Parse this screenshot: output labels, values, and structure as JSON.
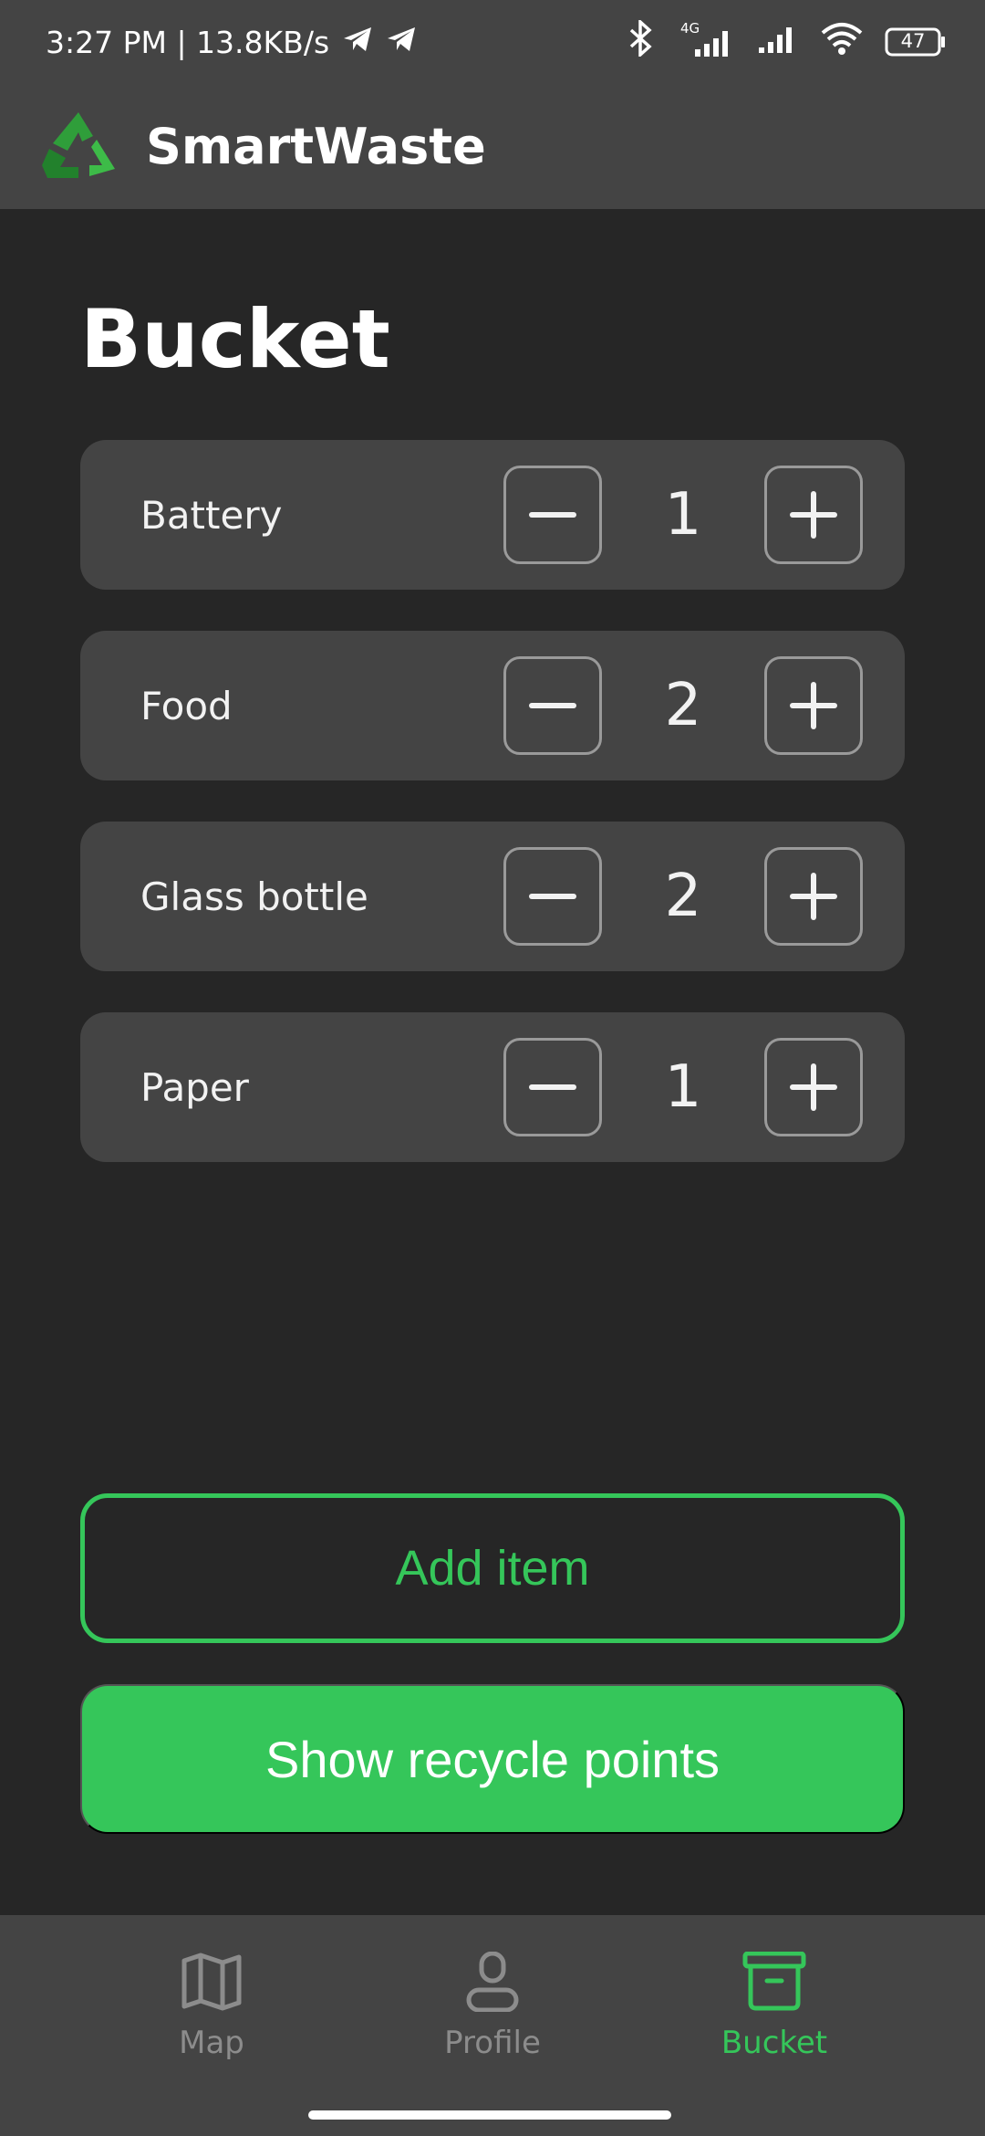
{
  "status_bar": {
    "time_speed": "3:27 PM | 13.8KB/s",
    "network_label": "4G",
    "battery": "47"
  },
  "app": {
    "title": "SmartWaste",
    "logo_icon": "recycle-icon"
  },
  "page": {
    "title": "Bucket"
  },
  "items": [
    {
      "label": "Battery",
      "quantity": "1"
    },
    {
      "label": "Food",
      "quantity": "2"
    },
    {
      "label": "Glass bottle",
      "quantity": "2"
    },
    {
      "label": "Paper",
      "quantity": "1"
    }
  ],
  "actions": {
    "add_item": "Add item",
    "show_recycle_points": "Show recycle points"
  },
  "bottom_nav": {
    "items": [
      {
        "label": "Map",
        "icon": "map-icon",
        "active": false
      },
      {
        "label": "Profile",
        "icon": "user-icon",
        "active": false
      },
      {
        "label": "Bucket",
        "icon": "archive-box-icon",
        "active": true
      }
    ]
  },
  "colors": {
    "accent": "#35c65a",
    "background": "#262626",
    "surface": "#444444"
  }
}
